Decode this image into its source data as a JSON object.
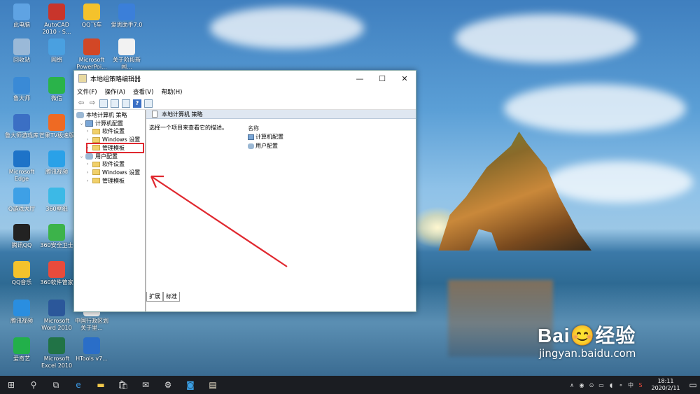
{
  "desktop": {
    "icons": [
      {
        "label": "此电脑",
        "color": "#5fa3e3"
      },
      {
        "label": "AutoCAD 2010 - S...",
        "color": "#c8352b"
      },
      {
        "label": "QQ飞车",
        "color": "#f4c22c"
      },
      {
        "label": "爱思助手7.0",
        "color": "#3b7fd9"
      },
      {
        "label": "回收站",
        "color": "#9ab9d8"
      },
      {
        "label": "网络",
        "color": "#4aa0e0"
      },
      {
        "label": "Microsoft PowerPoi...",
        "color": "#d24726"
      },
      {
        "label": "关于阶段新闻...",
        "color": "#f2f2f2"
      },
      {
        "label": "鲁大师",
        "color": "#3a8ad6"
      },
      {
        "label": "微信",
        "color": "#2ab34a"
      },
      {
        "label": "鲁大师游戏库",
        "color": "#3b6fc4"
      },
      {
        "label": "芒果TV极速版",
        "color": "#ef6a23"
      },
      {
        "label": "Microsoft Edge",
        "color": "#1e73c8"
      },
      {
        "label": "腾讯视频",
        "color": "#2aa1e8"
      },
      {
        "label": "Q游戏大厅",
        "color": "#3ea0e6"
      },
      {
        "label": "360壁纸",
        "color": "#3cb9e6"
      },
      {
        "label": "腾讯QQ",
        "color": "#222222"
      },
      {
        "label": "360安全卫士",
        "color": "#3cb34a"
      },
      {
        "label": "QQ音乐",
        "color": "#f4c22c"
      },
      {
        "label": "360软件管家",
        "color": "#e84b3c"
      },
      {
        "label": "腾讯视频",
        "color": "#2a8ee0"
      },
      {
        "label": "Microsoft Word 2010",
        "color": "#2b579a"
      },
      {
        "label": "中国行政区划关于里...",
        "color": "#eeeeee"
      },
      {
        "label": "爱奇艺",
        "color": "#22b04a"
      },
      {
        "label": "Microsoft Excel 2010",
        "color": "#217346"
      },
      {
        "label": "HTools v7...",
        "color": "#2a6ec8"
      }
    ]
  },
  "window": {
    "title": "本地组策略编辑器",
    "controls": {
      "minimize": "—",
      "maximize": "☐",
      "close": "✕"
    },
    "menu": [
      "文件(F)",
      "操作(A)",
      "查看(V)",
      "帮助(H)"
    ],
    "toolbar": {
      "back": "⇦",
      "forward": "⇨",
      "help": "?"
    },
    "tree": [
      {
        "label": "本地计算机 策略",
        "icon": "doc",
        "level": 0,
        "arrow": ""
      },
      {
        "label": "计算机配置",
        "icon": "pc",
        "level": 1,
        "arrow": "⌄"
      },
      {
        "label": "软件设置",
        "icon": "folder",
        "level": 2,
        "arrow": "›"
      },
      {
        "label": "Windows 设置",
        "icon": "folder",
        "level": 2,
        "arrow": "›"
      },
      {
        "label": "管理模板",
        "icon": "folder",
        "level": 2,
        "arrow": "›"
      },
      {
        "label": "用户配置",
        "icon": "user",
        "level": 1,
        "arrow": "⌄"
      },
      {
        "label": "软件设置",
        "icon": "folder",
        "level": 2,
        "arrow": "›"
      },
      {
        "label": "Windows 设置",
        "icon": "folder",
        "level": 2,
        "arrow": "›"
      },
      {
        "label": "管理模板",
        "icon": "folder",
        "level": 2,
        "arrow": "›"
      }
    ],
    "right_header": "本地计算机 策略",
    "description": "选择一个项目来查看它的描述。",
    "list_column": "名称",
    "list_items": [
      {
        "label": "计算机配置",
        "icon": "pc"
      },
      {
        "label": "用户配置",
        "icon": "user"
      }
    ],
    "tabs": [
      "扩展",
      "标准"
    ]
  },
  "annotation": {
    "color": "#e0282f"
  },
  "taskbar": {
    "buttons": [
      "start-icon",
      "search-icon",
      "task-view-icon",
      "edge-icon",
      "explorer-icon",
      "store-icon",
      "mail-icon",
      "app-icon",
      "qq-icon",
      "notepad-icon"
    ],
    "tray": [
      "∧",
      "◉",
      "⊙",
      "▭",
      "◖",
      "⚬",
      "中",
      "S"
    ],
    "time": "18:11",
    "date": "2020/2/11"
  },
  "watermark": {
    "brand": "Bai😊经验",
    "url": "jingyan.baidu.com"
  }
}
